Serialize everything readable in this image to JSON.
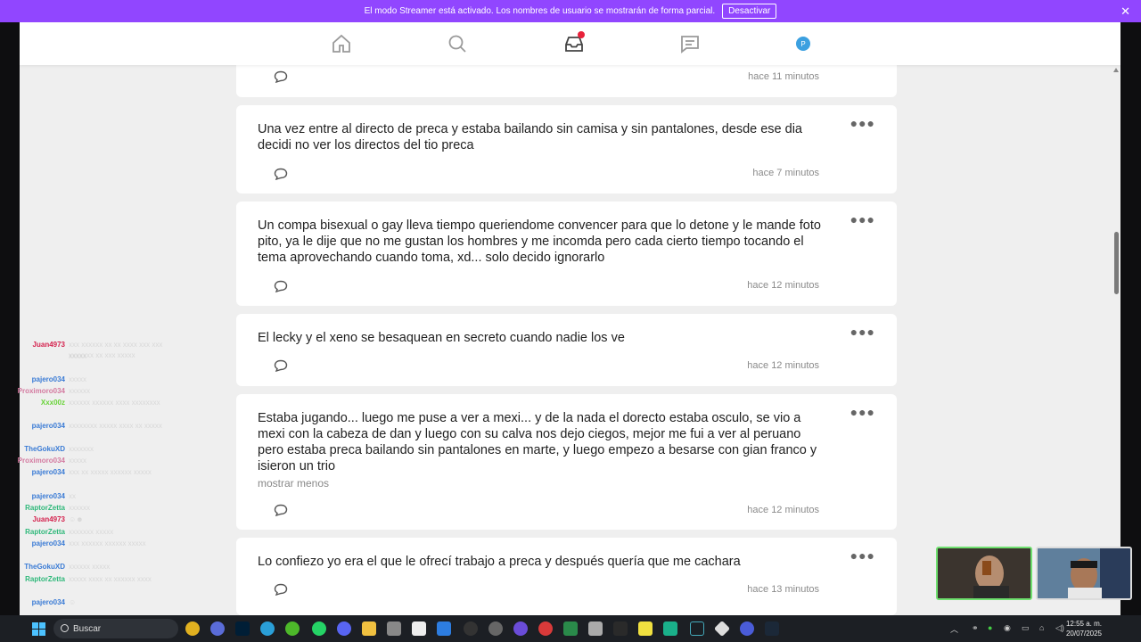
{
  "banner": {
    "message": "El modo Streamer está activado. Los nombres de usuario se mostrarán de forma parcial.",
    "button": "Desactivar",
    "close": "✕"
  },
  "topnav": {
    "items": [
      "home-icon",
      "search-icon",
      "inbox-icon",
      "messages-icon",
      "profile-avatar"
    ],
    "avatar_letter": "P",
    "accent": "#e8213a"
  },
  "posts": [
    {
      "text": "",
      "time": "hace 11 minutos",
      "more": ""
    },
    {
      "text": "Una vez entre al directo de preca y estaba bailando sin camisa y sin pantalones, desde ese dia decidi no ver los directos del tio preca",
      "time": "hace 7 minutos",
      "more": ""
    },
    {
      "text": "Un compa bisexual o gay lleva tiempo queriendome convencer para que lo detone y le mande foto pito, ya le dije que no me gustan los hombres y me incomda pero cada cierto tiempo tocando el tema aprovechando cuando toma, xd... solo decido ignorarlo",
      "time": "hace 12 minutos",
      "more": ""
    },
    {
      "text": "El lecky y el xeno se besaquean en secreto cuando nadie los ve",
      "time": "hace 12 minutos",
      "more": ""
    },
    {
      "text": "Estaba jugando... luego me puse a ver a mexi... y de la nada el dorecto estaba osculo, se vio a mexi con la cabeza de dan y luego con su calva nos dejo ciegos, mejor me fui a ver al peruano pero estaba preca bailando sin pantalones en marte, y luego empezo a besarse con gian franco y isieron un trio",
      "time": "hace 12 minutos",
      "more": "mostrar menos"
    },
    {
      "text": "Lo confiezo yo era el que le ofrecí trabajo a preca y después quería que me cachara",
      "time": "hace 13 minutos",
      "more": ""
    }
  ],
  "chat": [
    {
      "user": "Juan4973",
      "color": "#d4214d",
      "msg": "xxx xxxxxx xx xx xxxx xxx xxx xxxxxxx xx xxx xxxxx"
    },
    {
      "user": "",
      "color": "#ffffff",
      "msg": "xxxxx"
    },
    {
      "user": "pajero034",
      "color": "#3a7bd5",
      "msg": "xxxxx"
    },
    {
      "user": "Proximoro034",
      "color": "#d47aa0",
      "msg": "xxxxxx"
    },
    {
      "user": "Xxx00z",
      "color": "#6ad33a",
      "msg": "xxxxxx xxxxxx xxxx xxxxxxxx"
    },
    {
      "user": "pajero034",
      "color": "#3a7bd5",
      "msg": "xxxxxxxx xxxxx xxxx xx xxxxx"
    },
    {
      "user": "TheGokuXD",
      "color": "#3a7bd5",
      "msg": "xxxxxxx"
    },
    {
      "user": "Proximoro034",
      "color": "#d47aa0",
      "msg": "xxxxx"
    },
    {
      "user": "pajero034",
      "color": "#3a7bd5",
      "msg": "xxx xx xxxxx xxxxxx xxxxx"
    },
    {
      "user": "pajero034",
      "color": "#3a7bd5",
      "msg": "xx"
    },
    {
      "user": "RaptorZetta",
      "color": "#2fb87a",
      "msg": "xxxxxx"
    },
    {
      "user": "Juan4973",
      "color": "#d4214d",
      "msg": "☺☻"
    },
    {
      "user": "RaptorZetta",
      "color": "#2fb87a",
      "msg": "xxxxxxx xxxxx"
    },
    {
      "user": "pajero034",
      "color": "#3a7bd5",
      "msg": "xxx xxxxxx xxxxxx xxxxx"
    },
    {
      "user": "TheGokuXD",
      "color": "#3a7bd5",
      "msg": "xxxxxx xxxxx"
    },
    {
      "user": "RaptorZetta",
      "color": "#2fb87a",
      "msg": "xxxxx xxxx xx xxxxxx xxxx"
    },
    {
      "user": "pajero034",
      "color": "#3a7bd5",
      "msg": "☺"
    }
  ],
  "taskbar": {
    "search_placeholder": "Buscar",
    "time": "12:55 a. m.",
    "date": "20/07/2025"
  }
}
